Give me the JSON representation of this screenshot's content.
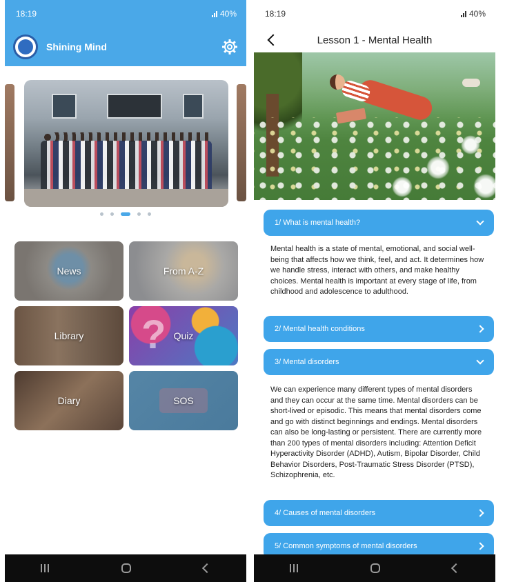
{
  "left": {
    "status": {
      "time": "18:19",
      "battery": "40%"
    },
    "app": {
      "name": "Shining Mind"
    },
    "icons": {
      "logo": "logo-icon",
      "settings": "gear-icon"
    },
    "carousel": {
      "total_dots": 5,
      "active_dot": 3
    },
    "menu": [
      {
        "label": "News"
      },
      {
        "label": "From A-Z"
      },
      {
        "label": "Library"
      },
      {
        "label": "Quiz"
      },
      {
        "label": "Diary"
      },
      {
        "label": "SOS"
      }
    ],
    "quiz_glyph": "?"
  },
  "right": {
    "status": {
      "time": "18:19",
      "battery": "40%"
    },
    "header": {
      "title": "Lesson 1 - Mental Health"
    },
    "sections": [
      {
        "label": "1/ What is mental health?",
        "expanded": true,
        "body": "Mental health is a state of mental, emotional, and social well-being that affects how we think, feel, and act. It determines how we handle stress, interact with others, and make healthy choices. Mental health is important at every stage of life, from childhood and adolescence to adulthood."
      },
      {
        "label": "2/ Mental health conditions",
        "expanded": false
      },
      {
        "label": "3/ Mental disorders",
        "expanded": true,
        "body": "We can experience many different types of mental disorders and they can occur at the same time. Mental disorders can be short-lived or episodic. This means that mental disorders come and go with distinct beginnings and endings. Mental disorders can also be long-lasting or persistent. There are currently more than 200 types of mental disorders including: Attention Deficit Hyperactivity Disorder (ADHD), Autism, Bipolar Disorder, Child Behavior Disorders, Post-Traumatic Stress Disorder (PTSD), Schizophrenia, etc."
      },
      {
        "label": "4/ Causes of mental disorders",
        "expanded": false
      },
      {
        "label": "5/ Common symptoms of mental disorders",
        "expanded": false
      }
    ]
  },
  "colors": {
    "accent": "#4aa8e8",
    "accordion": "#3fa5ea",
    "navbar": "#0d0d0d"
  }
}
